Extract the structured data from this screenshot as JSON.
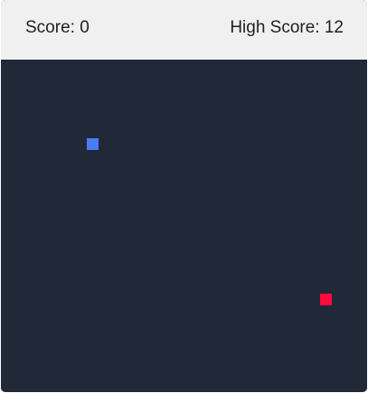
{
  "header": {
    "score_label": "Score: 0",
    "high_score_label": "High Score: 12",
    "score": 0,
    "high_score": 12
  },
  "board": {
    "background_color": "#212837",
    "snake_color": "#4c7cf3",
    "food_color": "#ff0a3d"
  }
}
